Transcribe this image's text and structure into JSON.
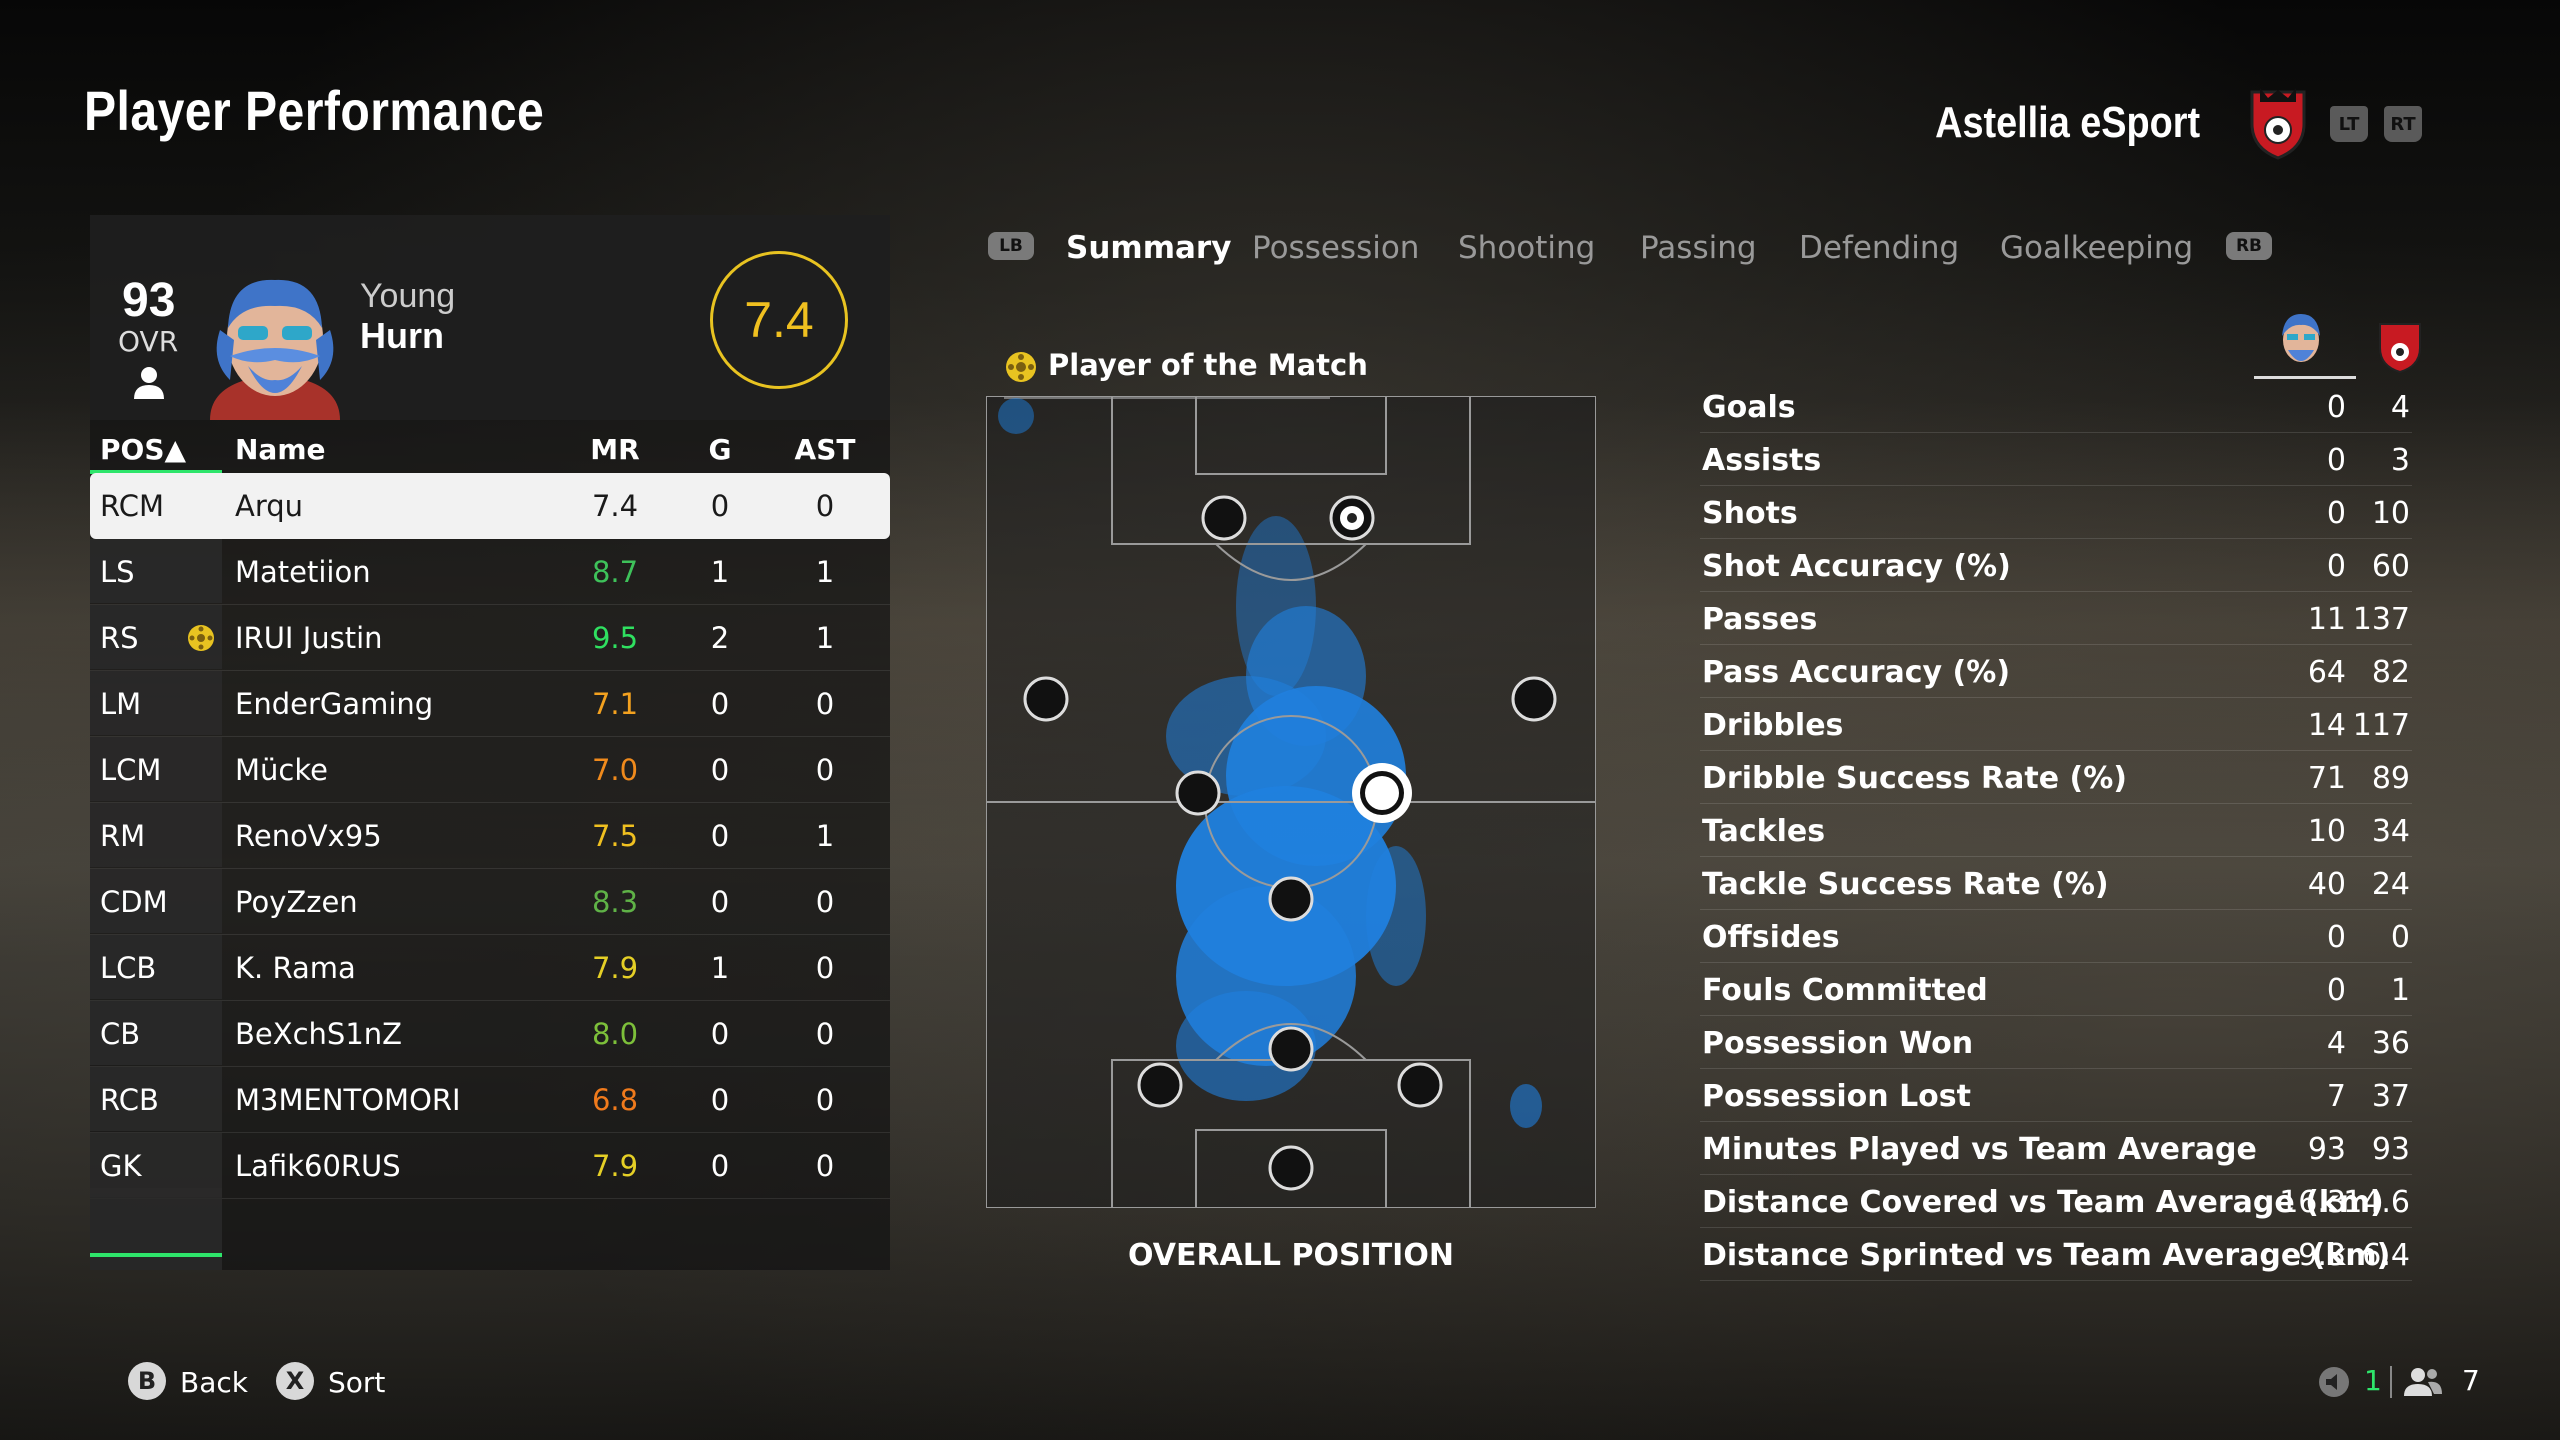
{
  "header": {
    "title": "Player Performance",
    "team_name": "Astellia eSport",
    "lt_label": "LT",
    "rt_label": "RT"
  },
  "player_card": {
    "ovr_value": "93",
    "ovr_label": "OVR",
    "name_line1": "Young",
    "name_line2": "Hurn",
    "match_rating": "7.4"
  },
  "table": {
    "headers": {
      "pos": "POS▲",
      "name": "Name",
      "mr": "MR",
      "g": "G",
      "ast": "AST"
    },
    "rows": [
      {
        "pos": "RCM",
        "name": "Arqu",
        "mr": "7.4",
        "g": "0",
        "ast": "0",
        "mr_color": "#1a1a1a",
        "selected": true
      },
      {
        "pos": "LS",
        "name": "Matetiion",
        "mr": "8.7",
        "g": "1",
        "ast": "1",
        "mr_color": "#3ec25a"
      },
      {
        "pos": "RS",
        "name": "IRUI Justin",
        "mr": "9.5",
        "g": "2",
        "ast": "1",
        "mr_color": "#2fe060",
        "motm": true
      },
      {
        "pos": "LM",
        "name": "EnderGaming",
        "mr": "7.1",
        "g": "0",
        "ast": "0",
        "mr_color": "#f3a11f"
      },
      {
        "pos": "LCM",
        "name": "Mücke",
        "mr": "7.0",
        "g": "0",
        "ast": "0",
        "mr_color": "#f08a1c"
      },
      {
        "pos": "RM",
        "name": "RenoVx95",
        "mr": "7.5",
        "g": "0",
        "ast": "1",
        "mr_color": "#f0c020"
      },
      {
        "pos": "CDM",
        "name": "PoyZzen",
        "mr": "8.3",
        "g": "0",
        "ast": "0",
        "mr_color": "#5fb247"
      },
      {
        "pos": "LCB",
        "name": "K. Rama",
        "mr": "7.9",
        "g": "1",
        "ast": "0",
        "mr_color": "#e5cf26"
      },
      {
        "pos": "CB",
        "name": "BeXchS1nZ",
        "mr": "8.0",
        "g": "0",
        "ast": "0",
        "mr_color": "#7dc03a"
      },
      {
        "pos": "RCB",
        "name": "M3MENTOMORI",
        "mr": "6.8",
        "g": "0",
        "ast": "0",
        "mr_color": "#f07a1c"
      },
      {
        "pos": "GK",
        "name": "Lafik60RUS",
        "mr": "7.9",
        "g": "0",
        "ast": "0",
        "mr_color": "#e5cf26"
      }
    ]
  },
  "tabs": {
    "lb_label": "LB",
    "rb_label": "RB",
    "items": [
      "Summary",
      "Possession",
      "Shooting",
      "Passing",
      "Defending",
      "Goalkeeping"
    ],
    "active": "Summary"
  },
  "pitch": {
    "motm_label": "Player of the Match",
    "caption": "OVERALL POSITION"
  },
  "stats": [
    {
      "label": "Goals",
      "player": "0",
      "team": "4"
    },
    {
      "label": "Assists",
      "player": "0",
      "team": "3"
    },
    {
      "label": "Shots",
      "player": "0",
      "team": "10"
    },
    {
      "label": "Shot Accuracy (%)",
      "player": "0",
      "team": "60"
    },
    {
      "label": "Passes",
      "player": "11",
      "team": "137"
    },
    {
      "label": "Pass Accuracy (%)",
      "player": "64",
      "team": "82"
    },
    {
      "label": "Dribbles",
      "player": "14",
      "team": "117"
    },
    {
      "label": "Dribble Success Rate (%)",
      "player": "71",
      "team": "89"
    },
    {
      "label": "Tackles",
      "player": "10",
      "team": "34"
    },
    {
      "label": "Tackle Success Rate (%)",
      "player": "40",
      "team": "24"
    },
    {
      "label": "Offsides",
      "player": "0",
      "team": "0"
    },
    {
      "label": "Fouls Committed",
      "player": "0",
      "team": "1"
    },
    {
      "label": "Possession Won",
      "player": "4",
      "team": "36"
    },
    {
      "label": "Possession Lost",
      "player": "7",
      "team": "37"
    },
    {
      "label": "Minutes Played vs Team Average",
      "player": "93",
      "team": "93"
    },
    {
      "label": "Distance Covered vs Team Average (km)",
      "player": "16.3",
      "team": "14.6"
    },
    {
      "label": "Distance Sprinted vs Team Average (km)",
      "player": "9.3",
      "team": "6.4"
    }
  ],
  "footer": {
    "back_button": "B",
    "back_label": "Back",
    "sort_button": "X",
    "sort_label": "Sort",
    "sound_count": "1",
    "users_count": "7"
  },
  "colors": {
    "accent_green": "#2ee56b",
    "rating_gold": "#f0c020",
    "heat_blue": "#1e90ff"
  }
}
